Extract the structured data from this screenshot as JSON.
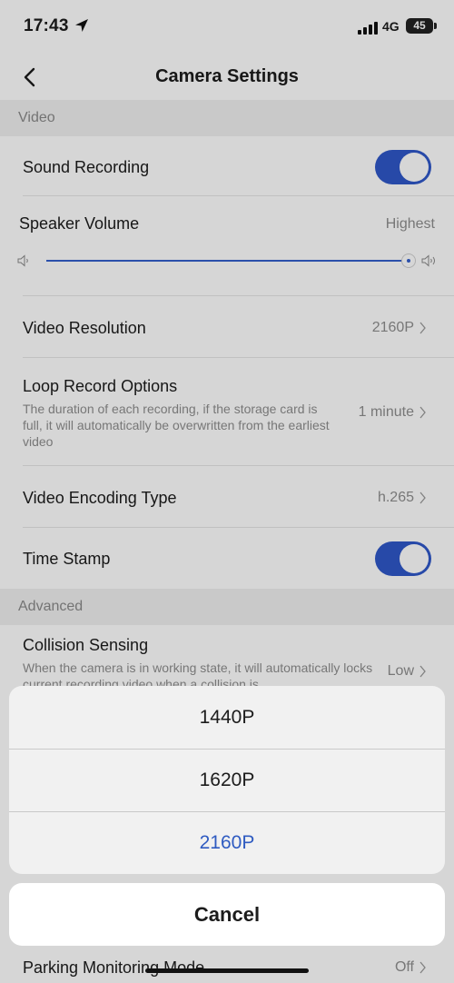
{
  "status_bar": {
    "time": "17:43",
    "network": "4G",
    "battery": "45"
  },
  "nav": {
    "title": "Camera Settings"
  },
  "sections": {
    "video": "Video",
    "advanced": "Advanced"
  },
  "rows": {
    "sound_recording": {
      "label": "Sound Recording",
      "on": true
    },
    "speaker_volume": {
      "label": "Speaker Volume",
      "value": "Highest",
      "level": 1.0
    },
    "video_resolution": {
      "label": "Video Resolution",
      "value": "2160P"
    },
    "loop_record": {
      "label": "Loop Record Options",
      "desc": "The duration of each recording, if the storage card is full, it will automatically be overwritten from the earliest video",
      "value": "1 minute"
    },
    "video_encoding": {
      "label": "Video Encoding Type",
      "value": "h.265"
    },
    "time_stamp": {
      "label": "Time Stamp",
      "on": true
    },
    "collision_sensing": {
      "label": "Collision Sensing",
      "desc": "When the camera is in working state, it will automatically locks current recording video when a collision is",
      "value": "Low"
    },
    "parking_monitoring": {
      "label": "Parking Monitoring Mode",
      "value": "Off"
    }
  },
  "action_sheet": {
    "options": [
      "1440P",
      "1620P",
      "2160P"
    ],
    "selected": "2160P",
    "cancel": "Cancel"
  },
  "colors": {
    "accent": "#2f57c9",
    "selected_text": "#2f5bc1"
  }
}
